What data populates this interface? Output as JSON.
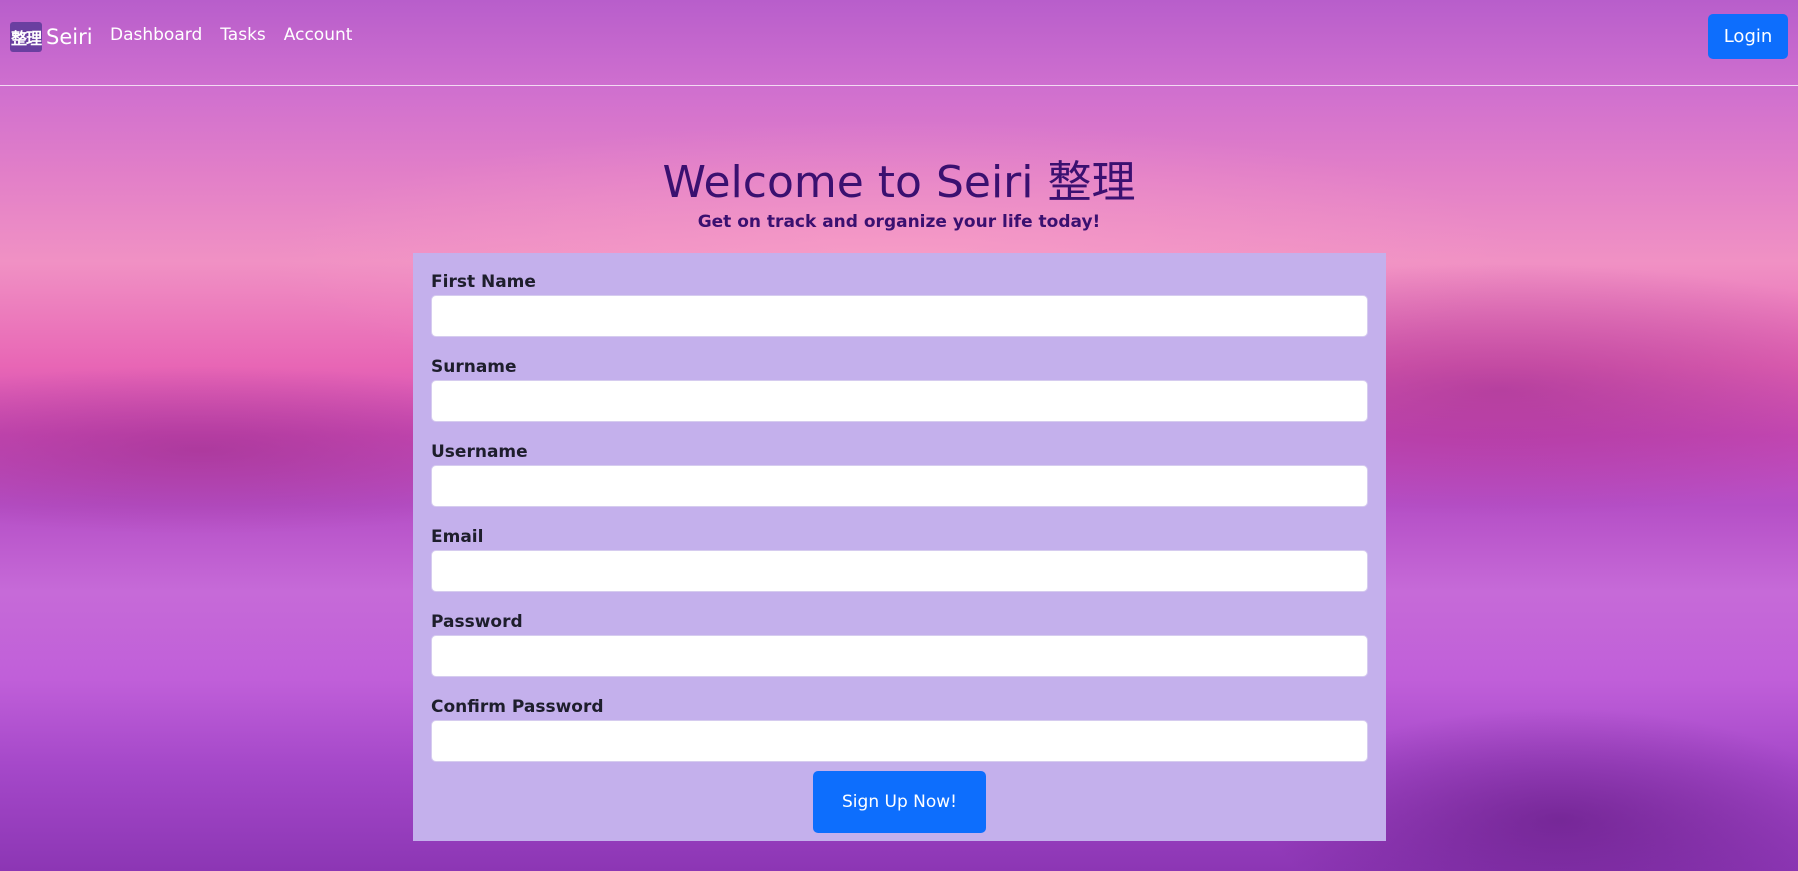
{
  "nav": {
    "brand_logo_text": "整理",
    "brand_name": "Seiri",
    "links": [
      "Dashboard",
      "Tasks",
      "Account"
    ],
    "login_label": "Login"
  },
  "hero": {
    "title": "Welcome to Seiri 整理",
    "subtitle": "Get on track and organize your life today!"
  },
  "form": {
    "fields": [
      {
        "label": "First Name",
        "value": ""
      },
      {
        "label": "Surname",
        "value": ""
      },
      {
        "label": "Username",
        "value": ""
      },
      {
        "label": "Email",
        "value": ""
      },
      {
        "label": "Password",
        "value": ""
      },
      {
        "label": "Confirm Password",
        "value": ""
      }
    ],
    "submit_label": "Sign Up Now!"
  },
  "colors": {
    "accent": "#0d6efd",
    "form_background": "#c4b0ec",
    "heading": "#3a1070"
  }
}
